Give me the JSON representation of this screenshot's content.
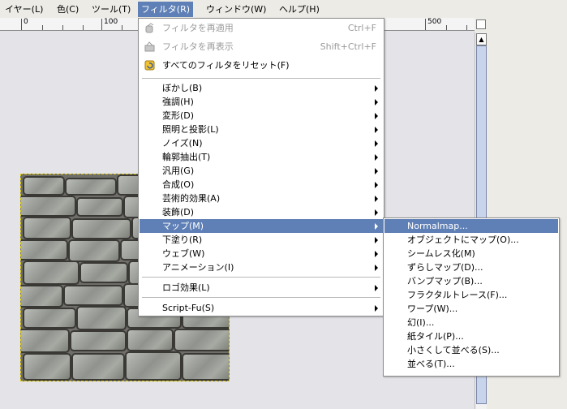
{
  "menubar": {
    "items": [
      "イヤー(L)",
      "色(C)",
      "ツール(T)",
      "フィルタ(R)",
      "ウィンドウ(W)",
      "ヘルプ(H)"
    ],
    "items_display": [
      "ィヤー(",
      "色(",
      "ツール(",
      "フィルタ(",
      "ウィンドウ(",
      "ヘルプ("
    ],
    "mn": [
      "L",
      "C",
      "T",
      "R",
      "W",
      "H"
    ],
    "active": "フィルタ(R)"
  },
  "ruler": {
    "labels": [
      "0",
      "100",
      "500"
    ]
  },
  "filter_menu": {
    "repeat": {
      "label": "フィルタを再適用",
      "shortcut": "Ctrl+F"
    },
    "reshow": {
      "label": "フィルタを再表示",
      "shortcut": "Shift+Ctrl+F"
    },
    "reset": {
      "label": "すべてのフィルタをリセット(F)"
    },
    "submenus": [
      "ぼかし(B)",
      "強調(H)",
      "変形(D)",
      "照明と投影(L)",
      "ノイズ(N)",
      "輪郭抽出(T)",
      "汎用(G)",
      "合成(O)",
      "芸術的効果(A)",
      "装飾(D)",
      "マップ(M)",
      "下塗り(R)",
      "ウェブ(W)",
      "アニメーション(I)"
    ],
    "logo": "ロゴ効果(L)",
    "script_fu": "Script-Fu(S)",
    "highlighted": "マップ(M)"
  },
  "map_menu": {
    "items": [
      "Normalmap...",
      "オブジェクトにマップ(O)...",
      "シームレス化(M)",
      "ずらしマップ(D)...",
      "バンプマップ(B)...",
      "フラクタルトレース(F)...",
      "ワープ(W)...",
      "幻(I)...",
      "紙タイル(P)...",
      "小さくして並べる(S)...",
      "並べる(T)..."
    ],
    "highlighted": "Normalmap..."
  },
  "colors": {
    "highlight": "#5f80b6",
    "menu_bg": "#ffffff",
    "disabled_text": "#9a9a9a",
    "selection_border": "#d8c400"
  },
  "icons": {
    "repeat": "filter-repeat-icon",
    "reshow": "filter-reshow-icon",
    "reset": "filter-reset-icon"
  }
}
